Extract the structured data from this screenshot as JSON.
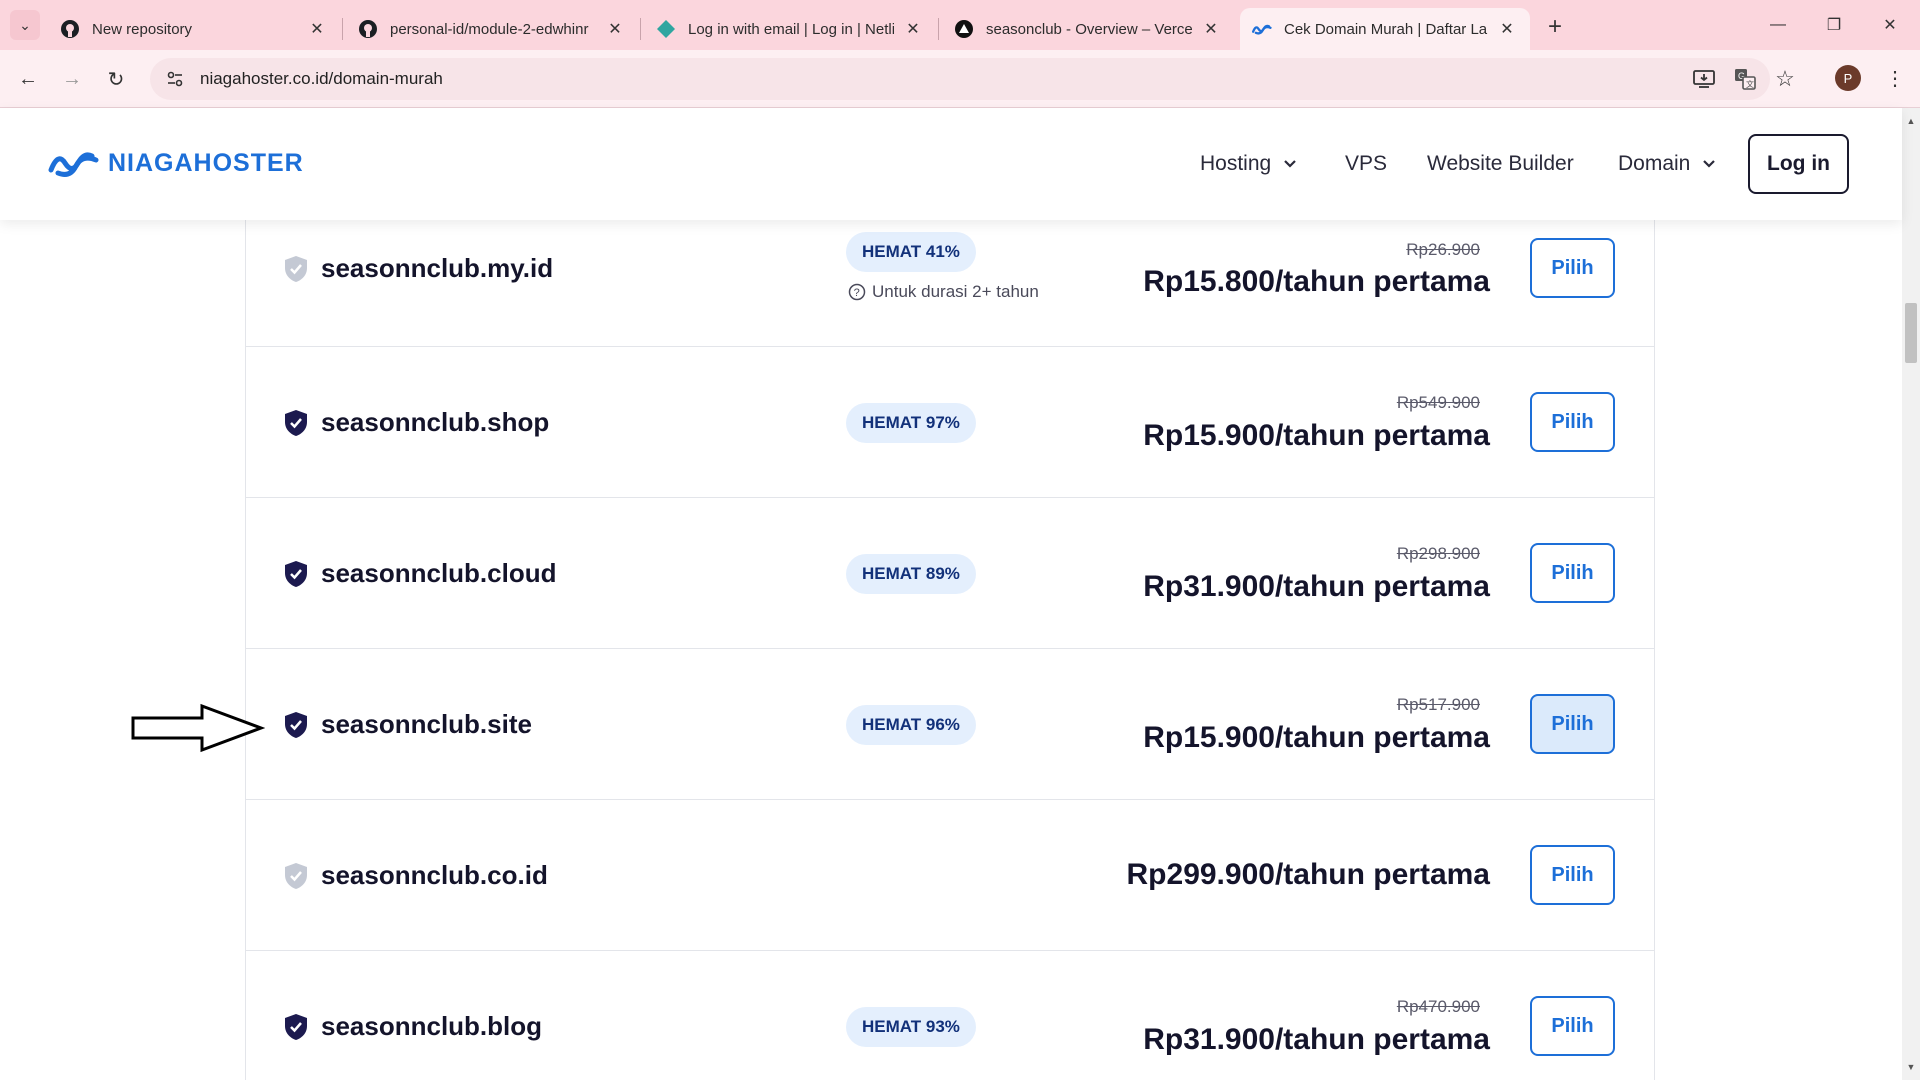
{
  "browser": {
    "tabs": [
      {
        "title": "New repository",
        "icon": "github-icon"
      },
      {
        "title": "personal-id/module-2-edwhinr",
        "icon": "github-icon"
      },
      {
        "title": "Log in with email | Log in | Netlify",
        "icon": "netlify-icon"
      },
      {
        "title": "seasonclub - Overview – Vercel",
        "icon": "vercel-icon"
      },
      {
        "title": "Cek Domain Murah | Daftar Lang",
        "icon": "niagahoster-icon",
        "active": true
      }
    ],
    "url": "niagahoster.co.id/domain-murah",
    "profile_initial": "P",
    "accent_color": "#fbd6dd"
  },
  "header": {
    "logo_text": "NIAGAHOSTER",
    "nav": {
      "hosting": "Hosting",
      "vps": "VPS",
      "website_builder": "Website Builder",
      "domain": "Domain"
    },
    "login_label": "Log in",
    "brand_color": "#1d6fd8"
  },
  "results": [
    {
      "domain": "seasonnclub.my.id",
      "badge": "HEMAT 41%",
      "note": "Untuk durasi 2+ tahun",
      "old_price": "Rp26.900",
      "price": "Rp15.800/tahun pertama",
      "button": "Pilih",
      "shield": "grey"
    },
    {
      "domain": "seasonnclub.shop",
      "badge": "HEMAT 97%",
      "note": "",
      "old_price": "Rp549.900",
      "price": "Rp15.900/tahun pertama",
      "button": "Pilih",
      "shield": "dark"
    },
    {
      "domain": "seasonnclub.cloud",
      "badge": "HEMAT 89%",
      "note": "",
      "old_price": "Rp298.900",
      "price": "Rp31.900/tahun pertama",
      "button": "Pilih",
      "shield": "dark"
    },
    {
      "domain": "seasonnclub.site",
      "badge": "HEMAT 96%",
      "note": "",
      "old_price": "Rp517.900",
      "price": "Rp15.900/tahun pertama",
      "button": "Pilih",
      "shield": "dark",
      "hover": true
    },
    {
      "domain": "seasonnclub.co.id",
      "badge": "",
      "note": "",
      "old_price": "",
      "price": "Rp299.900/tahun pertama",
      "button": "Pilih",
      "shield": "grey"
    },
    {
      "domain": "seasonnclub.blog",
      "badge": "HEMAT 93%",
      "note": "",
      "old_price": "Rp470.900",
      "price": "Rp31.900/tahun pertama",
      "button": "Pilih",
      "shield": "dark"
    }
  ]
}
